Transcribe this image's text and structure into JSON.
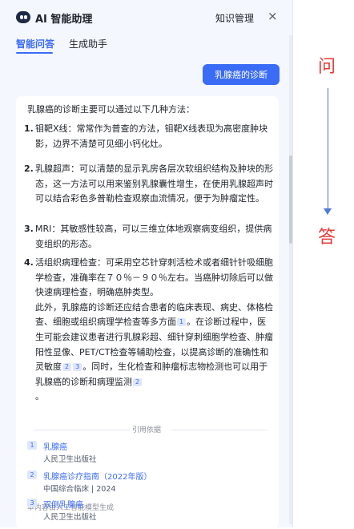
{
  "header": {
    "title": "AI 智能助理",
    "knowledge_label": "知识管理",
    "close_label": "×"
  },
  "tabs": [
    {
      "label": "智能问答"
    },
    {
      "label": "生成助手"
    }
  ],
  "question": "乳腺癌的诊断",
  "answer": {
    "intro": "乳腺癌的诊断主要可以通过以下几种方法：",
    "items": [
      {
        "num": "1.",
        "text": "钼靶X线：常常作为普查的方法，钼靶X线表现为高密度肿块影，边界不清楚可见细小钙化灶。"
      },
      {
        "num": "2.",
        "text": "乳腺超声：可以清楚的显示乳房各层次软组织结构及肿块的形态，这一方法可以用来鉴别乳腺囊性增生，在使用乳腺超声时可以结合彩色多普勒检查观察血流情况，便于为肿瘤定性。"
      },
      {
        "num": "3.",
        "text": "MRI：其敏感性较高，可以三维立体地观察病变组织，提供病变组织的形态。"
      },
      {
        "num": "4.",
        "text_a": "活组织病理检查：可采用空芯针穿刺活检术或者细针针吸细胞学检查，准确率在７０％－９０％左右。当癌肿切除后可以做快速病理检查，明确癌肿类型。",
        "text_b": "此外，乳腺癌的诊断还应结合患者的临床表现、病史、体格检查、细胞或组织病理学检查等多方面",
        "ref1": "1",
        "text_c": "。在诊断过程中，医生可能会建议患者进行乳腺彩超、细针穿刺细胞学检查、肿瘤阳性显像、PET/CT检查等辅助检查，以提高诊断的准确性和灵敏度",
        "ref2": "2",
        "ref3": "3",
        "text_d": "。同时，生化检查和肿瘤标志物检测也可以用于乳腺癌的诊断和病理监测",
        "ref4": "2",
        "text_e": "。"
      }
    ],
    "note": "本内容由人工智能模型生成"
  },
  "references": {
    "heading": "引用依据",
    "items": [
      {
        "num": "1",
        "title": "乳腺癌",
        "source": "人民卫生出版社"
      },
      {
        "num": "2",
        "title": "乳腺癌诊疗指南（2022年版）",
        "source": "中国综合临床 | 2024"
      },
      {
        "num": "3",
        "title": "双侧乳腺癌",
        "source": "人民卫生出版社"
      }
    ]
  },
  "annotations": {
    "question_char": "问",
    "answer_char": "答"
  },
  "colors": {
    "accent": "#3b6cf6",
    "annotation": "#e53935",
    "arrow": "#4a7bd6"
  }
}
